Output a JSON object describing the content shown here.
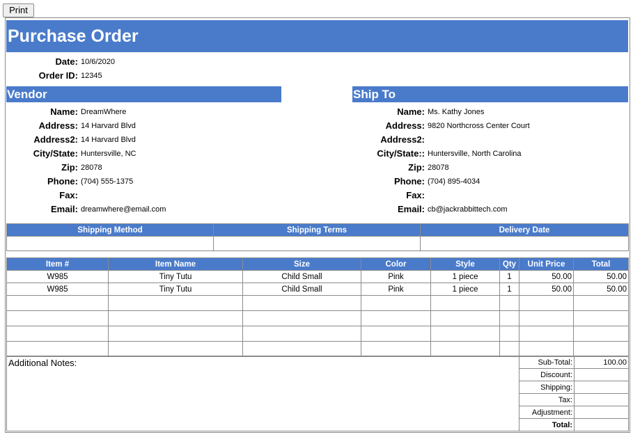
{
  "print_label": "Print",
  "title": "Purchase Order",
  "meta": [
    {
      "label": "Date:",
      "value": "10/6/2020"
    },
    {
      "label": "Order ID:",
      "value": "12345"
    }
  ],
  "vendor": {
    "heading": "Vendor",
    "fields": [
      {
        "label": "Name:",
        "value": "DreamWhere"
      },
      {
        "label": "Address:",
        "value": "14 Harvard Blvd"
      },
      {
        "label": "Address2:",
        "value": "14 Harvard Blvd"
      },
      {
        "label": "City/State:",
        "value": "Huntersville, NC"
      },
      {
        "label": "Zip:",
        "value": "28078"
      },
      {
        "label": "Phone:",
        "value": "(704) 555-1375"
      },
      {
        "label": "Fax:",
        "value": ""
      },
      {
        "label": "Email:",
        "value": "dreamwhere@email.com"
      }
    ]
  },
  "ship_to": {
    "heading": "Ship To",
    "fields": [
      {
        "label": "Name:",
        "value": "Ms. Kathy Jones"
      },
      {
        "label": "Address:",
        "value": "9820 Northcross Center Court"
      },
      {
        "label": "Address2:",
        "value": ""
      },
      {
        "label": "City/State::",
        "value": "Huntersville, North Carolina"
      },
      {
        "label": "Zip:",
        "value": "28078"
      },
      {
        "label": "Phone:",
        "value": "(704) 895-4034"
      },
      {
        "label": "Fax:",
        "value": ""
      },
      {
        "label": "Email:",
        "value": "cb@jackrabbittech.com"
      }
    ]
  },
  "shipping": {
    "headers": [
      "Shipping Method",
      "Shipping Terms",
      "Delivery Date"
    ],
    "values": [
      "",
      "",
      ""
    ]
  },
  "items": {
    "headers": [
      "Item #",
      "Item Name",
      "Size",
      "Color",
      "Style",
      "Qty",
      "Unit Price",
      "Total"
    ],
    "rows": [
      [
        "W985",
        "Tiny Tutu",
        "Child Small",
        "Pink",
        "1 piece",
        "1",
        "50.00",
        "50.00"
      ],
      [
        "W985",
        "Tiny Tutu",
        "Child Small",
        "Pink",
        "1 piece",
        "1",
        "50.00",
        "50.00"
      ]
    ]
  },
  "notes_label": "Additional Notes:",
  "totals": [
    {
      "label": "Sub-Total:",
      "value": "100.00"
    },
    {
      "label": "Discount:",
      "value": ""
    },
    {
      "label": "Shipping:",
      "value": ""
    },
    {
      "label": "Tax:",
      "value": ""
    },
    {
      "label": "Adjustment:",
      "value": ""
    },
    {
      "label": "Total:",
      "value": ""
    }
  ]
}
